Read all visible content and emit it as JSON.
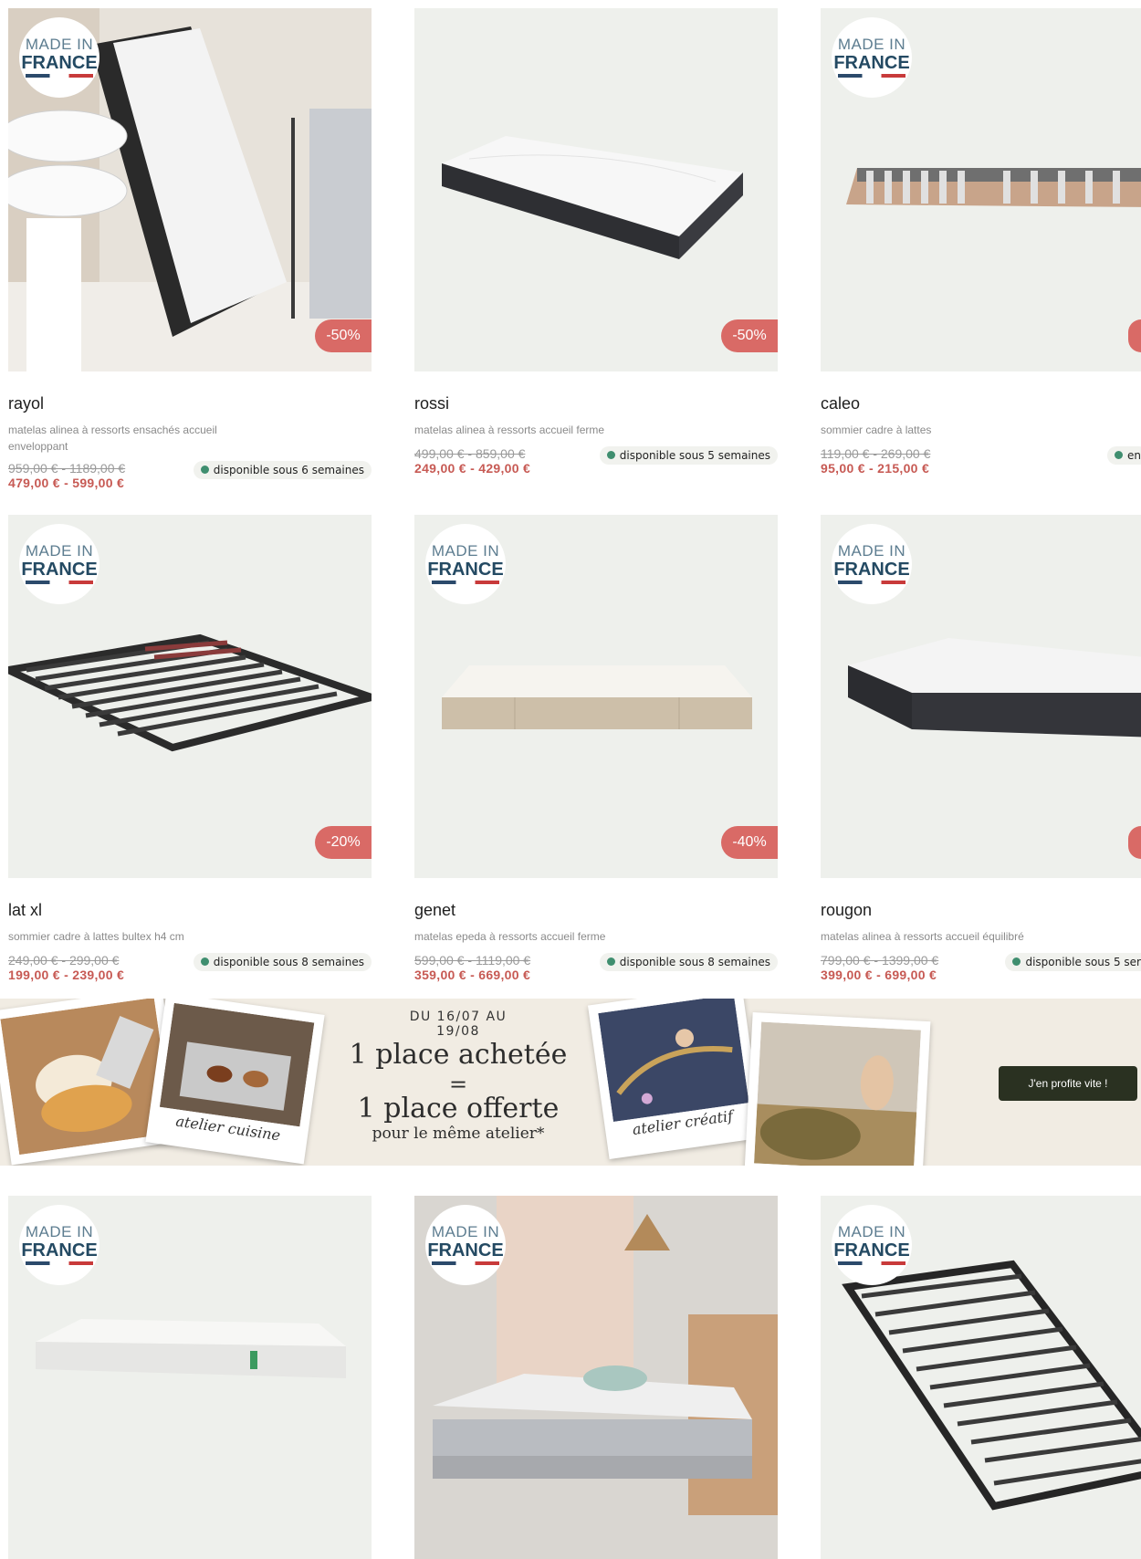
{
  "products": [
    {
      "name": "rayol",
      "desc": "matelas alinea à ressorts ensachés accueil enveloppant",
      "old": "959,00 € - 1189,00 €",
      "price": "479,00 € - 599,00 €",
      "discount": "-50%",
      "avail": "disponible sous 6 semaines",
      "badge_l1": "MADE IN",
      "badge_l2": "FRANCE"
    },
    {
      "name": "rossi",
      "desc": "matelas alinea à ressorts accueil ferme",
      "old": "499,00 € - 859,00 €",
      "price": "249,00 € - 429,00 €",
      "discount": "-50%",
      "avail": "disponible sous 5 semaines"
    },
    {
      "name": "caleo",
      "desc": "sommier cadre à lattes",
      "old": "119,00 € - 269,00 €",
      "price": "95,00 € - 215,00 €",
      "avail": "en",
      "badge_l1": "MADE IN",
      "badge_l2": "FRANCE"
    },
    {
      "name": "lat xl",
      "desc": "sommier cadre à lattes bultex h4 cm",
      "old": "249,00 € - 299,00 €",
      "price": "199,00 € - 239,00 €",
      "discount": "-20%",
      "avail": "disponible sous 8 semaines",
      "badge_l1": "MADE IN",
      "badge_l2": "FRANCE"
    },
    {
      "name": "genet",
      "desc": "matelas epeda à ressorts accueil ferme",
      "old": "599,00 € - 1119,00 €",
      "price": "359,00 € - 669,00 €",
      "discount": "-40%",
      "avail": "disponible sous 8 semaines",
      "badge_l1": "MADE IN",
      "badge_l2": "FRANCE"
    },
    {
      "name": "rougon",
      "desc": "matelas alinea à ressorts accueil équilibré",
      "old": "799,00 € - 1399,00 €",
      "price": "399,00 € - 699,00 €",
      "avail": "disponible sous 5 ser",
      "badge_l1": "MADE IN",
      "badge_l2": "FRANCE"
    },
    {
      "badge_l1": "MADE IN",
      "badge_l2": "FRANCE"
    },
    {
      "badge_l1": "MADE IN",
      "badge_l2": "FRANCE"
    },
    {
      "badge_l1": "MADE IN",
      "badge_l2": "FRANCE"
    }
  ],
  "banner": {
    "date": "DU 16/07 AU 19/08",
    "line1": "1 place achetée",
    "equals": "=",
    "line2": "1 place offerte",
    "line3": "pour le même atelier*",
    "caption_left": "atelier cuisine",
    "caption_right": "atelier créatif",
    "cta": "J'en profite vite !"
  },
  "colors": {
    "discount": "#d96a66",
    "price": "#c75a54",
    "available_dot": "#3f8e6f",
    "cta": "#2a3121",
    "card_bg": "#eef0ec"
  }
}
